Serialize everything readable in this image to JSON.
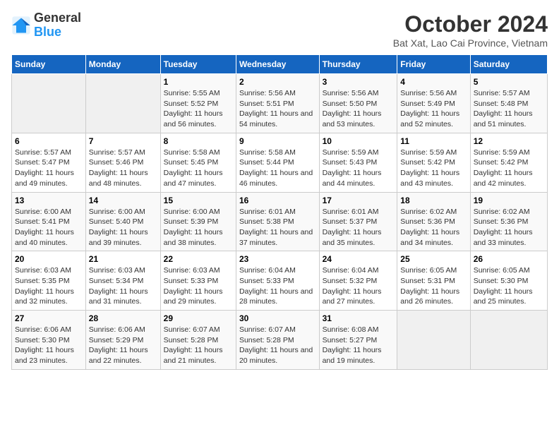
{
  "header": {
    "logo_general": "General",
    "logo_blue": "Blue",
    "month_title": "October 2024",
    "location": "Bat Xat, Lao Cai Province, Vietnam"
  },
  "days_of_week": [
    "Sunday",
    "Monday",
    "Tuesday",
    "Wednesday",
    "Thursday",
    "Friday",
    "Saturday"
  ],
  "weeks": [
    [
      {
        "day": "",
        "info": ""
      },
      {
        "day": "",
        "info": ""
      },
      {
        "day": "1",
        "info": "Sunrise: 5:55 AM\nSunset: 5:52 PM\nDaylight: 11 hours and 56 minutes."
      },
      {
        "day": "2",
        "info": "Sunrise: 5:56 AM\nSunset: 5:51 PM\nDaylight: 11 hours and 54 minutes."
      },
      {
        "day": "3",
        "info": "Sunrise: 5:56 AM\nSunset: 5:50 PM\nDaylight: 11 hours and 53 minutes."
      },
      {
        "day": "4",
        "info": "Sunrise: 5:56 AM\nSunset: 5:49 PM\nDaylight: 11 hours and 52 minutes."
      },
      {
        "day": "5",
        "info": "Sunrise: 5:57 AM\nSunset: 5:48 PM\nDaylight: 11 hours and 51 minutes."
      }
    ],
    [
      {
        "day": "6",
        "info": "Sunrise: 5:57 AM\nSunset: 5:47 PM\nDaylight: 11 hours and 49 minutes."
      },
      {
        "day": "7",
        "info": "Sunrise: 5:57 AM\nSunset: 5:46 PM\nDaylight: 11 hours and 48 minutes."
      },
      {
        "day": "8",
        "info": "Sunrise: 5:58 AM\nSunset: 5:45 PM\nDaylight: 11 hours and 47 minutes."
      },
      {
        "day": "9",
        "info": "Sunrise: 5:58 AM\nSunset: 5:44 PM\nDaylight: 11 hours and 46 minutes."
      },
      {
        "day": "10",
        "info": "Sunrise: 5:59 AM\nSunset: 5:43 PM\nDaylight: 11 hours and 44 minutes."
      },
      {
        "day": "11",
        "info": "Sunrise: 5:59 AM\nSunset: 5:42 PM\nDaylight: 11 hours and 43 minutes."
      },
      {
        "day": "12",
        "info": "Sunrise: 5:59 AM\nSunset: 5:42 PM\nDaylight: 11 hours and 42 minutes."
      }
    ],
    [
      {
        "day": "13",
        "info": "Sunrise: 6:00 AM\nSunset: 5:41 PM\nDaylight: 11 hours and 40 minutes."
      },
      {
        "day": "14",
        "info": "Sunrise: 6:00 AM\nSunset: 5:40 PM\nDaylight: 11 hours and 39 minutes."
      },
      {
        "day": "15",
        "info": "Sunrise: 6:00 AM\nSunset: 5:39 PM\nDaylight: 11 hours and 38 minutes."
      },
      {
        "day": "16",
        "info": "Sunrise: 6:01 AM\nSunset: 5:38 PM\nDaylight: 11 hours and 37 minutes."
      },
      {
        "day": "17",
        "info": "Sunrise: 6:01 AM\nSunset: 5:37 PM\nDaylight: 11 hours and 35 minutes."
      },
      {
        "day": "18",
        "info": "Sunrise: 6:02 AM\nSunset: 5:36 PM\nDaylight: 11 hours and 34 minutes."
      },
      {
        "day": "19",
        "info": "Sunrise: 6:02 AM\nSunset: 5:36 PM\nDaylight: 11 hours and 33 minutes."
      }
    ],
    [
      {
        "day": "20",
        "info": "Sunrise: 6:03 AM\nSunset: 5:35 PM\nDaylight: 11 hours and 32 minutes."
      },
      {
        "day": "21",
        "info": "Sunrise: 6:03 AM\nSunset: 5:34 PM\nDaylight: 11 hours and 31 minutes."
      },
      {
        "day": "22",
        "info": "Sunrise: 6:03 AM\nSunset: 5:33 PM\nDaylight: 11 hours and 29 minutes."
      },
      {
        "day": "23",
        "info": "Sunrise: 6:04 AM\nSunset: 5:33 PM\nDaylight: 11 hours and 28 minutes."
      },
      {
        "day": "24",
        "info": "Sunrise: 6:04 AM\nSunset: 5:32 PM\nDaylight: 11 hours and 27 minutes."
      },
      {
        "day": "25",
        "info": "Sunrise: 6:05 AM\nSunset: 5:31 PM\nDaylight: 11 hours and 26 minutes."
      },
      {
        "day": "26",
        "info": "Sunrise: 6:05 AM\nSunset: 5:30 PM\nDaylight: 11 hours and 25 minutes."
      }
    ],
    [
      {
        "day": "27",
        "info": "Sunrise: 6:06 AM\nSunset: 5:30 PM\nDaylight: 11 hours and 23 minutes."
      },
      {
        "day": "28",
        "info": "Sunrise: 6:06 AM\nSunset: 5:29 PM\nDaylight: 11 hours and 22 minutes."
      },
      {
        "day": "29",
        "info": "Sunrise: 6:07 AM\nSunset: 5:28 PM\nDaylight: 11 hours and 21 minutes."
      },
      {
        "day": "30",
        "info": "Sunrise: 6:07 AM\nSunset: 5:28 PM\nDaylight: 11 hours and 20 minutes."
      },
      {
        "day": "31",
        "info": "Sunrise: 6:08 AM\nSunset: 5:27 PM\nDaylight: 11 hours and 19 minutes."
      },
      {
        "day": "",
        "info": ""
      },
      {
        "day": "",
        "info": ""
      }
    ]
  ]
}
